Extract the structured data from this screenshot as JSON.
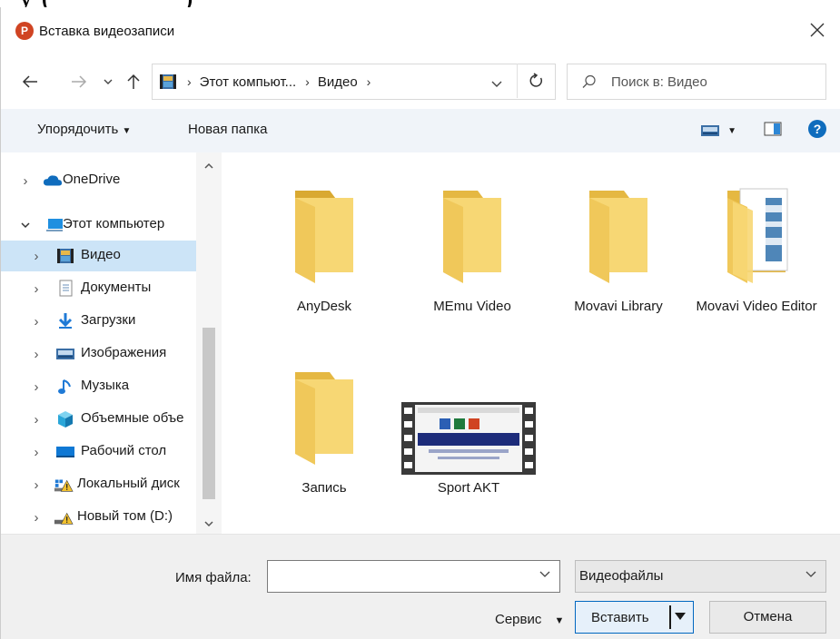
{
  "background_text": "у (                 )",
  "window": {
    "title": "Вставка видеозаписи",
    "app_icon_letter": "P",
    "app_icon_color": "#d04423"
  },
  "address": {
    "crumbs": [
      "Этот компьют...",
      "Видео"
    ],
    "search_placeholder": "Поиск в: Видео"
  },
  "toolbar": {
    "organize_label": "Упорядочить",
    "new_folder_label": "Новая папка",
    "help_color": "#0f6cbd"
  },
  "nav": {
    "items": [
      {
        "label": "OneDrive",
        "icon": "cloud-icon"
      },
      {
        "label": "Этот компьютер",
        "icon": "computer-icon"
      },
      {
        "label": "Видео",
        "icon": "video-folder-icon"
      },
      {
        "label": "Документы",
        "icon": "documents-icon"
      },
      {
        "label": "Загрузки",
        "icon": "downloads-icon"
      },
      {
        "label": "Изображения",
        "icon": "pictures-icon"
      },
      {
        "label": "Музыка",
        "icon": "music-icon"
      },
      {
        "label": "Объемные объе",
        "icon": "3d-objects-icon"
      },
      {
        "label": "Рабочий стол",
        "icon": "desktop-icon"
      },
      {
        "label": "Локальный диск",
        "icon": "drive-warning-icon"
      },
      {
        "label": "Новый том (D:)",
        "icon": "drive-warning-icon"
      }
    ],
    "selected_color": "#cce4f7"
  },
  "files": [
    {
      "name": "AnyDesk",
      "type": "folder"
    },
    {
      "name": "MEmu Video",
      "type": "folder"
    },
    {
      "name": "Movavi Library",
      "type": "folder"
    },
    {
      "name": "Movavi Video Editor",
      "type": "folder-with-files"
    },
    {
      "name": "Запись",
      "type": "folder"
    },
    {
      "name": "Sport AKT",
      "type": "video"
    }
  ],
  "footer": {
    "filename_label": "Имя файла:",
    "filename_value": "",
    "filetype_value": "Видеофайлы",
    "service_label": "Сервис",
    "insert_label": "Вставить",
    "cancel_label": "Отмена"
  }
}
